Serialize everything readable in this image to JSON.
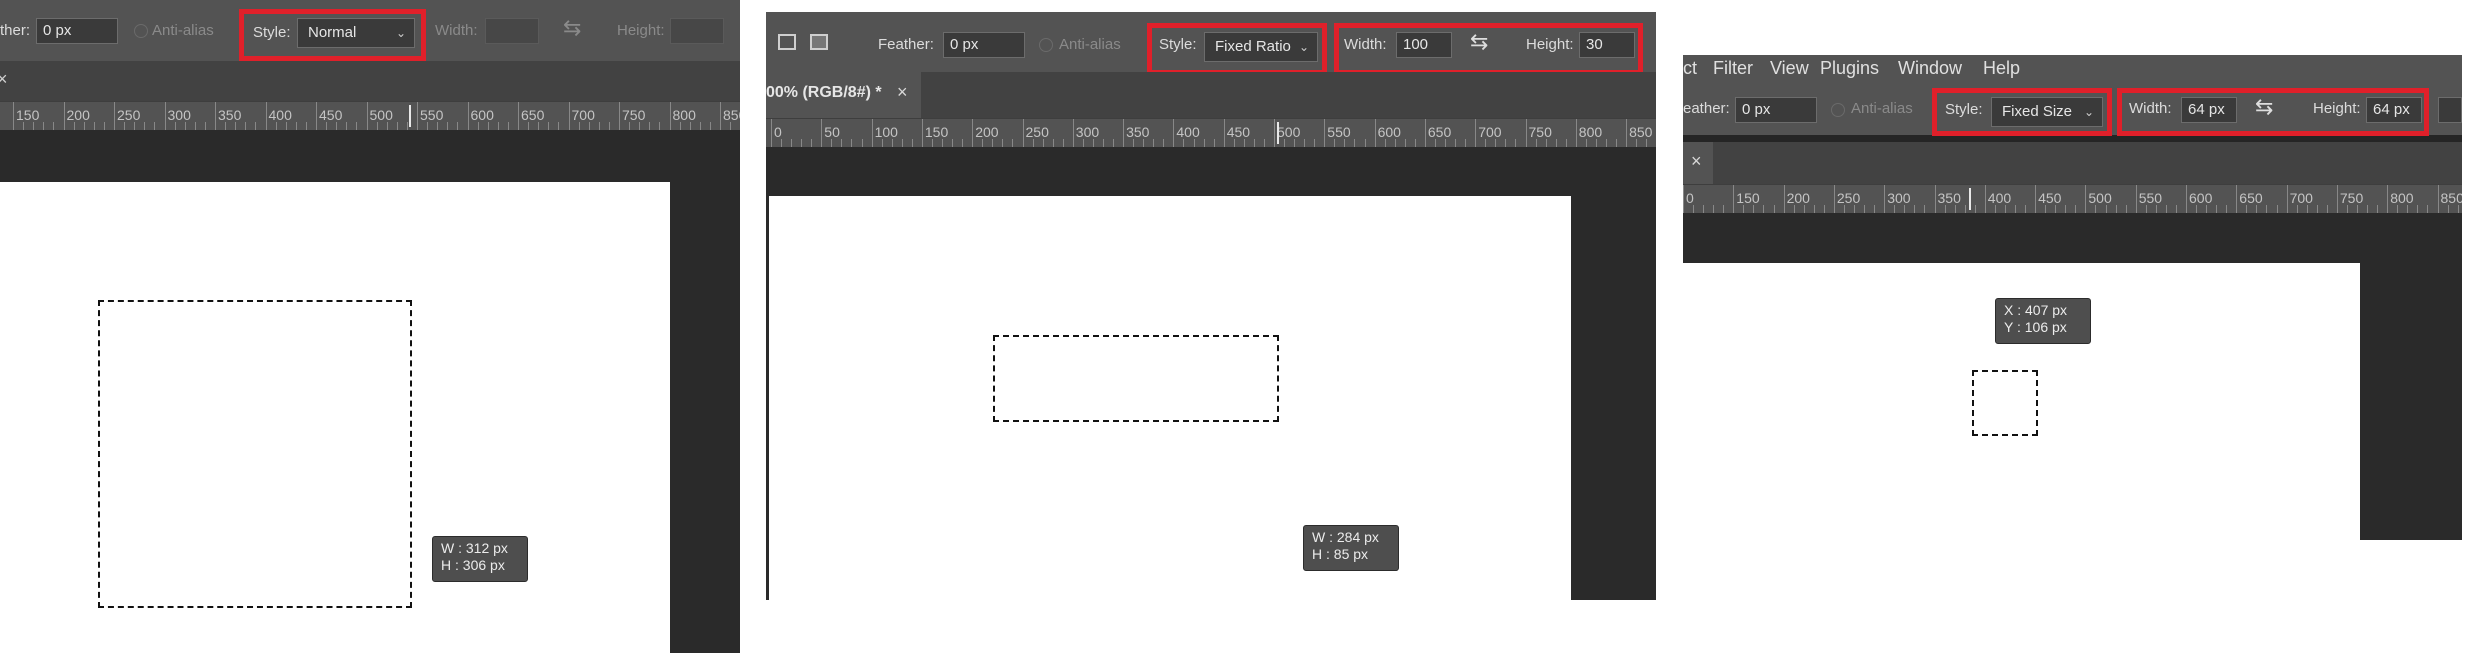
{
  "panel1": {
    "feather_label": "ther:",
    "feather_value": "0 px",
    "anti_alias_label": "Anti-alias",
    "style_label": "Style:",
    "style_value": "Normal",
    "width_label": "Width:",
    "height_label": "Height:",
    "ruler_ticks": [
      "150",
      "200",
      "250",
      "300",
      "350",
      "400",
      "450",
      "500",
      "550",
      "600",
      "650",
      "700",
      "750",
      "800",
      "850"
    ],
    "tooltip": {
      "w": "W :  312 px",
      "h": "H :  306 px"
    }
  },
  "panel2": {
    "feather_label": "Feather:",
    "feather_value": "0 px",
    "anti_alias_label": "Anti-alias",
    "style_label": "Style:",
    "style_value": "Fixed Ratio",
    "width_label": "Width:",
    "width_value": "100",
    "height_label": "Height:",
    "height_value": "30",
    "tab_title": "00% (RGB/8#) *",
    "tab_close": "×",
    "ruler_ticks": [
      "0",
      "50",
      "100",
      "150",
      "200",
      "250",
      "300",
      "350",
      "400",
      "450",
      "500",
      "550",
      "600",
      "650",
      "700",
      "750",
      "800",
      "850"
    ],
    "tooltip": {
      "w": "W :  284 px",
      "h": "H :    85 px"
    }
  },
  "panel3": {
    "menu": [
      "ct",
      "Filter",
      "View",
      "Plugins",
      "Window",
      "Help"
    ],
    "feather_label": "eather:",
    "feather_value": "0 px",
    "anti_alias_label": "Anti-alias",
    "style_label": "Style:",
    "style_value": "Fixed Size",
    "width_label": "Width:",
    "width_value": "64 px",
    "height_label": "Height:",
    "height_value": "64 px",
    "tab_close": "×",
    "ruler_ticks": [
      "0",
      "150",
      "200",
      "250",
      "300",
      "350",
      "400",
      "450",
      "500",
      "550",
      "600",
      "650",
      "700",
      "750",
      "800",
      "850"
    ],
    "tooltip": {
      "x": "X :  407 px",
      "y": "Y :  106 px"
    }
  },
  "colors": {
    "highlight": "#e0202a",
    "toolbar": "#535353",
    "workspace": "#2a2a2a"
  },
  "icons": [
    "chevron-down-icon",
    "swap-arrows-icon",
    "close-icon",
    "selection-mode-icon"
  ]
}
